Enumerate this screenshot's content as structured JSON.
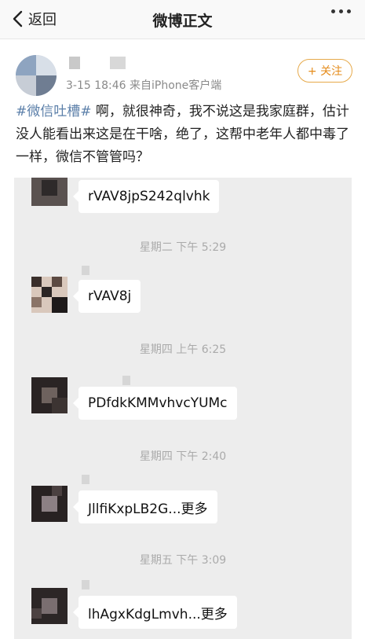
{
  "navbar": {
    "back_label": "返回",
    "title": "微博正文"
  },
  "author": {
    "meta": "3-15 18:46 来自iPhone客户端",
    "follow_label": "+ 关注"
  },
  "post": {
    "hashtag": "#微信吐槽#",
    "body": " 啊，就很神奇，我不说这是我家庭群，估计没人能看出来这是在干啥，绝了，这帮中老年人都中毒了一样，微信不管管吗？"
  },
  "chat": {
    "messages": [
      {
        "text": "rVAV8jpS242qlvhk"
      },
      {
        "timestamp": "星期二 下午 5:29",
        "text": "rVAV8j"
      },
      {
        "timestamp": "星期四 上午 6:25",
        "text": "PDfdkKMMvhvcYUMc"
      },
      {
        "timestamp": "星期四 下午 2:40",
        "text": "JllfiKxpLB2G...更多"
      },
      {
        "timestamp": "星期五 下午 3:09",
        "text": "lhAgxKdgLmvh...更多"
      }
    ]
  },
  "colors": {
    "hashtag": "#5b7fa9",
    "follow_accent": "#e58b1a",
    "chat_background": "#ededed"
  },
  "icons": {
    "back": "chevron-left-icon",
    "more": "more-dots-icon"
  }
}
